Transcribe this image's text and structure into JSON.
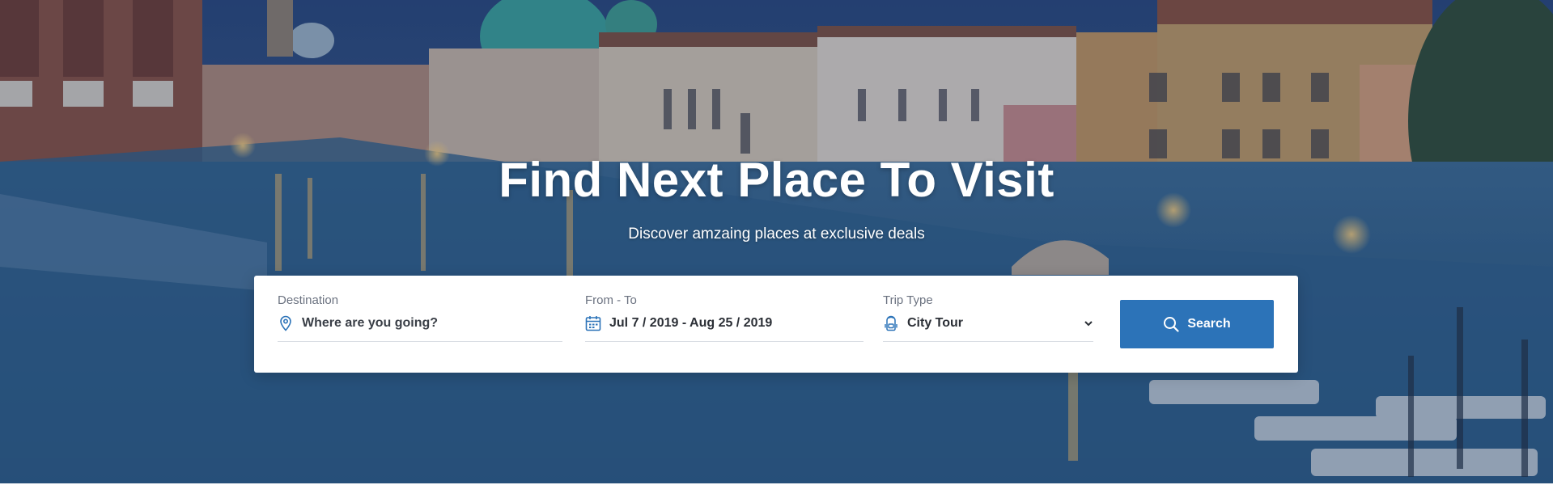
{
  "hero": {
    "title": "Find Next Place To Visit",
    "subtitle": "Discover amzaing places at exclusive deals"
  },
  "search": {
    "destination": {
      "label": "Destination",
      "placeholder": "Where are you going?",
      "icon": "map-pin-icon"
    },
    "dates": {
      "label": "From - To",
      "value": "Jul 7 / 2019 - Aug 25 / 2019",
      "icon": "calendar-icon"
    },
    "trip_type": {
      "label": "Trip Type",
      "value": "City Tour",
      "icon": "backpack-icon"
    },
    "button_label": "Search",
    "button_icon": "search-icon"
  },
  "colors": {
    "accent": "#2c73b8",
    "overlay": "#1e325a",
    "card": "#ffffff"
  }
}
